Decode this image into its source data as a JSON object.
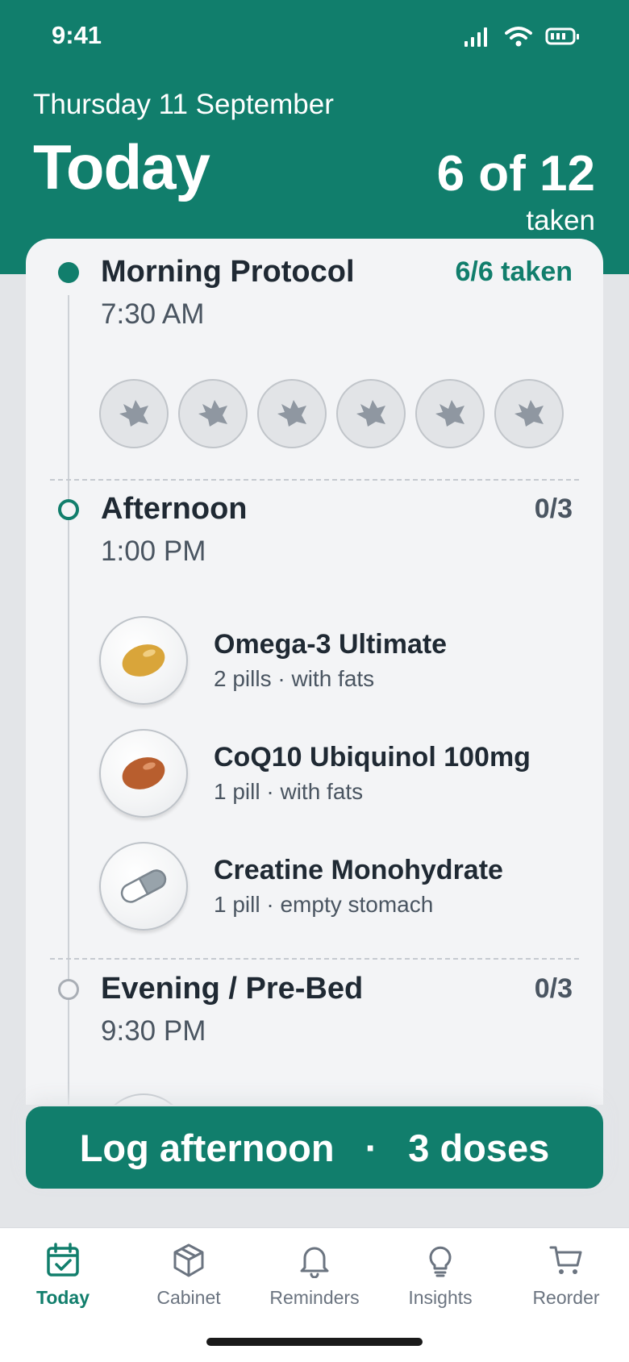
{
  "status_bar": {
    "time": "9:41"
  },
  "header": {
    "date": "Thursday 11 September",
    "title": "Today",
    "progress_count": "6 of 12",
    "progress_label": "taken"
  },
  "sections": [
    {
      "title": "Morning Protocol",
      "time": "7:30 AM",
      "status": "6/6 taken",
      "state": "done",
      "pill_count": 6
    },
    {
      "title": "Afternoon",
      "time": "1:00 PM",
      "status": "0/3",
      "state": "active",
      "meds": [
        {
          "name": "Omega-3 Ultimate",
          "detail": "2 pills · with fats",
          "icon": "softgel-gold-icon"
        },
        {
          "name": "CoQ10 Ubiquinol 100mg",
          "detail": "1 pill · with fats",
          "icon": "softgel-brown-icon"
        },
        {
          "name": "Creatine Monohydrate",
          "detail": "1 pill · empty stomach",
          "icon": "capsule-icon"
        }
      ]
    },
    {
      "title": "Evening / Pre-Bed",
      "time": "9:30 PM",
      "status": "0/3",
      "state": "pending"
    }
  ],
  "log_button": {
    "label": "Log afternoon",
    "separator": "·",
    "doses": "3 doses"
  },
  "tabs": [
    {
      "label": "Today",
      "icon": "calendar-check-icon",
      "active": true
    },
    {
      "label": "Cabinet",
      "icon": "box-icon",
      "active": false
    },
    {
      "label": "Reminders",
      "icon": "bell-icon",
      "active": false
    },
    {
      "label": "Insights",
      "icon": "lightbulb-icon",
      "active": false
    },
    {
      "label": "Reorder",
      "icon": "cart-icon",
      "active": false
    }
  ],
  "colors": {
    "brand": "#117E6C",
    "background": "#E3E5E8",
    "card": "#F3F4F6",
    "text": "#1F2933",
    "muted": "#4A5561"
  }
}
